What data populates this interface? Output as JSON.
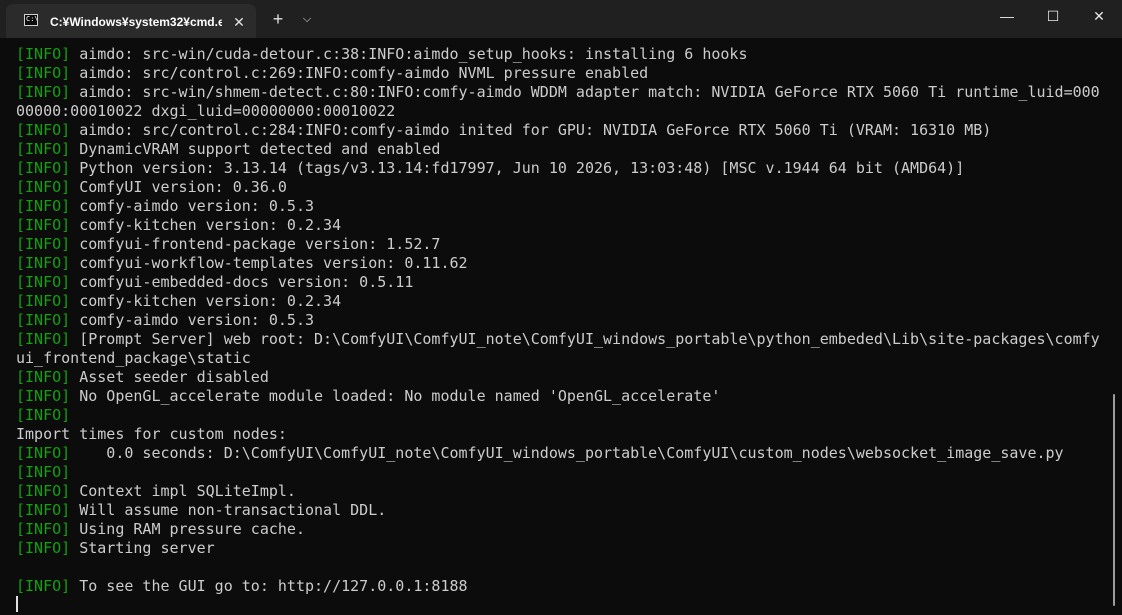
{
  "titlebar": {
    "tab_title": "C:¥Windows¥system32¥cmd.e",
    "tab_icon_text": "C:\\",
    "close_tab_glyph": "✕",
    "new_tab_glyph": "+",
    "dropdown_glyph": "⌵",
    "minimize_glyph": "—",
    "maximize_glyph": "☐",
    "close_glyph": "✕"
  },
  "terminal": {
    "lines": [
      {
        "tag": "[INFO]",
        "text": " aimdo: src-win/cuda-detour.c:38:INFO:aimdo_setup_hooks: installing 6 hooks"
      },
      {
        "tag": "[INFO]",
        "text": " aimdo: src/control.c:269:INFO:comfy-aimdo NVML pressure enabled"
      },
      {
        "tag": "[INFO]",
        "text": " aimdo: src-win/shmem-detect.c:80:INFO:comfy-aimdo WDDM adapter match: NVIDIA GeForce RTX 5060 Ti runtime_luid=000"
      },
      {
        "tag": "",
        "text": "00000:00010022 dxgi_luid=00000000:00010022"
      },
      {
        "tag": "[INFO]",
        "text": " aimdo: src/control.c:284:INFO:comfy-aimdo inited for GPU: NVIDIA GeForce RTX 5060 Ti (VRAM: 16310 MB)"
      },
      {
        "tag": "[INFO]",
        "text": " DynamicVRAM support detected and enabled"
      },
      {
        "tag": "[INFO]",
        "text": " Python version: 3.13.14 (tags/v3.13.14:fd17997, Jun 10 2026, 13:03:48) [MSC v.1944 64 bit (AMD64)]"
      },
      {
        "tag": "[INFO]",
        "text": " ComfyUI version: 0.36.0"
      },
      {
        "tag": "[INFO]",
        "text": " comfy-aimdo version: 0.5.3"
      },
      {
        "tag": "[INFO]",
        "text": " comfy-kitchen version: 0.2.34"
      },
      {
        "tag": "[INFO]",
        "text": " comfyui-frontend-package version: 1.52.7"
      },
      {
        "tag": "[INFO]",
        "text": " comfyui-workflow-templates version: 0.11.62"
      },
      {
        "tag": "[INFO]",
        "text": " comfyui-embedded-docs version: 0.5.11"
      },
      {
        "tag": "[INFO]",
        "text": " comfy-kitchen version: 0.2.34"
      },
      {
        "tag": "[INFO]",
        "text": " comfy-aimdo version: 0.5.3"
      },
      {
        "tag": "[INFO]",
        "text": " [Prompt Server] web root: D:\\ComfyUI\\ComfyUI_note\\ComfyUI_windows_portable\\python_embeded\\Lib\\site-packages\\comfy"
      },
      {
        "tag": "",
        "text": "ui_frontend_package\\static"
      },
      {
        "tag": "[INFO]",
        "text": " Asset seeder disabled"
      },
      {
        "tag": "[INFO]",
        "text": " No OpenGL_accelerate module loaded: No module named 'OpenGL_accelerate'"
      },
      {
        "tag": "[INFO]",
        "text": ""
      },
      {
        "tag": "",
        "text": "Import times for custom nodes:"
      },
      {
        "tag": "[INFO]",
        "text": "    0.0 seconds: D:\\ComfyUI\\ComfyUI_note\\ComfyUI_windows_portable\\ComfyUI\\custom_nodes\\websocket_image_save.py"
      },
      {
        "tag": "[INFO]",
        "text": ""
      },
      {
        "tag": "[INFO]",
        "text": " Context impl SQLiteImpl."
      },
      {
        "tag": "[INFO]",
        "text": " Will assume non-transactional DDL."
      },
      {
        "tag": "[INFO]",
        "text": " Using RAM pressure cache."
      },
      {
        "tag": "[INFO]",
        "text": " Starting server"
      },
      {
        "tag": "",
        "text": ""
      },
      {
        "tag": "[INFO]",
        "text": " To see the GUI go to: http://127.0.0.1:8188"
      }
    ]
  },
  "colors": {
    "info_tag": "#13a10e",
    "text": "#cccccc",
    "background": "#0c0c0c",
    "titlebar": "#202020",
    "active_tab": "#2b2b2b"
  }
}
